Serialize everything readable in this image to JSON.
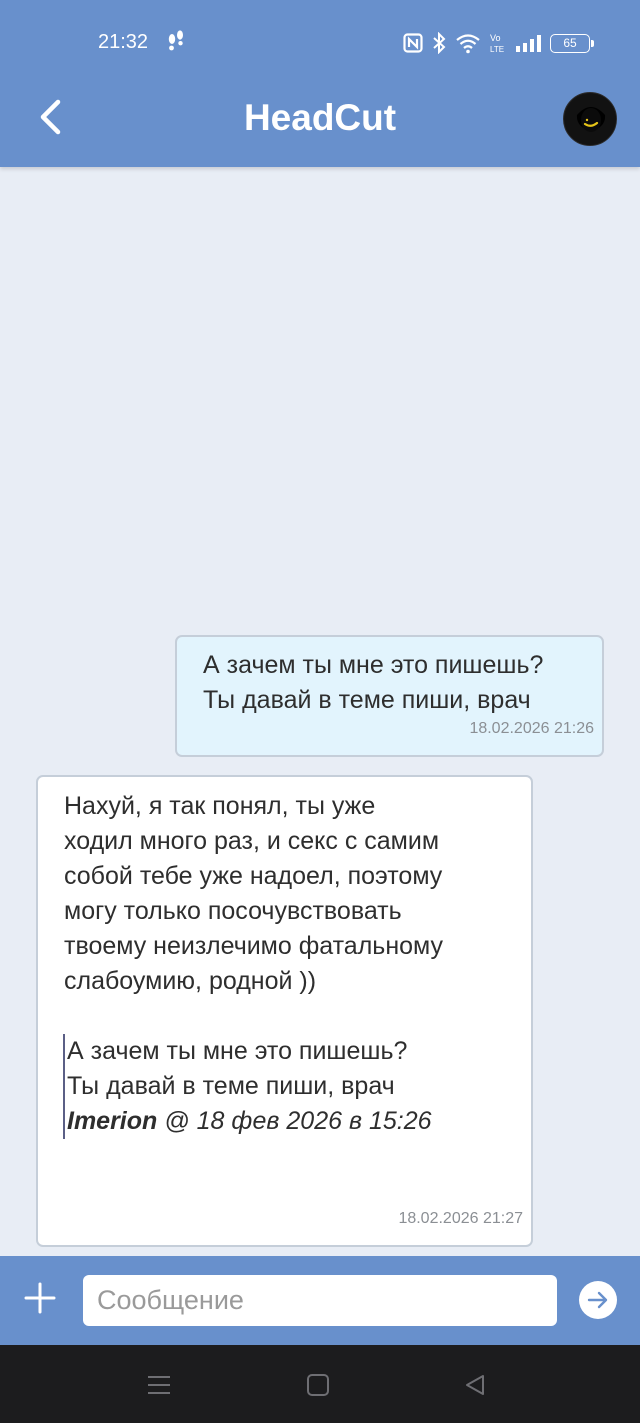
{
  "status_bar": {
    "time": "21:32",
    "battery_level": "65",
    "icons": [
      "footsteps-icon",
      "nfc-icon",
      "bluetooth-icon",
      "wifi-icon",
      "volte-icon",
      "signal-icon",
      "battery-icon"
    ]
  },
  "header": {
    "title": "HeadCut",
    "back_icon": "chevron-left-icon",
    "avatar_icon": "avatar-icon"
  },
  "colors": {
    "header_bg": "#6890cc",
    "chat_bg": "#e8edf5",
    "outgoing_bubble": "#e2f4fd",
    "incoming_bubble": "#ffffff",
    "navbar_bg": "#1c1c1e"
  },
  "messages": [
    {
      "direction": "outgoing",
      "lines": [
        "А зачем ты мне это пишешь?",
        "Ты давай в теме пиши, врач"
      ],
      "time": "18.02.2026 21:26"
    },
    {
      "direction": "incoming",
      "lines": [
        "Нахуй, я так понял, ты уже",
        "ходил много раз, и секс с самим",
        "собой тебе уже надоел, поэтому",
        "могу только посочувствовать",
        "твоему неизлечимо фатальному",
        "слабоумию, родной ))"
      ],
      "quote": {
        "lines": [
          "А зачем ты мне это пишешь?",
          "Ты давай в теме пиши, врач"
        ],
        "author": "Imerion",
        "meta": " @ 18 фев 2026 в 15:26"
      },
      "time": "18.02.2026 21:27"
    }
  ],
  "input_bar": {
    "placeholder": "Сообщение",
    "value": "",
    "plus_icon": "plus-icon",
    "send_icon": "send-arrow-icon"
  },
  "nav_bar": {
    "icons": [
      "menu-icon",
      "home-square-icon",
      "back-triangle-icon"
    ]
  }
}
